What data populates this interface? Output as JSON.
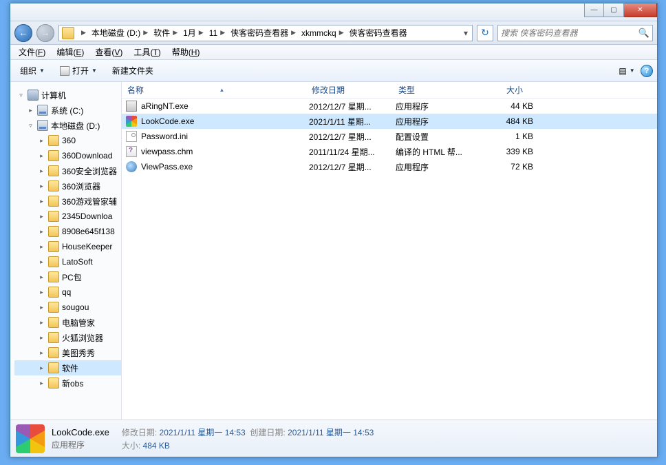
{
  "titlebar": {
    "min": "—",
    "max": "▢",
    "close": "✕"
  },
  "nav": {
    "back": "←",
    "fwd": "→"
  },
  "breadcrumbs": [
    {
      "label": "本地磁盘 (D:)"
    },
    {
      "label": "软件"
    },
    {
      "label": "1月"
    },
    {
      "label": "11"
    },
    {
      "label": "侠客密码查看器"
    },
    {
      "label": "xkmmckq"
    },
    {
      "label": "侠客密码查看器"
    }
  ],
  "search": {
    "placeholder": "搜索 侠客密码查看器"
  },
  "menus": [
    {
      "label": "文件",
      "key": "F"
    },
    {
      "label": "编辑",
      "key": "E"
    },
    {
      "label": "查看",
      "key": "V"
    },
    {
      "label": "工具",
      "key": "T"
    },
    {
      "label": "帮助",
      "key": "H"
    }
  ],
  "toolbar": {
    "organize": "组织",
    "open": "打开",
    "newfolder": "新建文件夹"
  },
  "tree": {
    "computer": "计算机",
    "system": "系统 (C:)",
    "local": "本地磁盘 (D:)",
    "folders": [
      "360",
      "360Download",
      "360安全浏览器",
      "360浏览器",
      "360游戏管家辅",
      "2345Downloa",
      "8908e645f138",
      "HouseKeeper",
      "LatoSoft",
      "PC包",
      "qq",
      "sougou",
      "电脑管家",
      "火狐浏览器",
      "美图秀秀",
      "软件",
      "新obs"
    ]
  },
  "columns": {
    "name": "名称",
    "date": "修改日期",
    "type": "类型",
    "size": "大小"
  },
  "files": [
    {
      "ico": "exe",
      "name": "aRingNT.exe",
      "date": "2012/12/7 星期...",
      "type": "应用程序",
      "size": "44 KB",
      "sel": false
    },
    {
      "ico": "exe2",
      "name": "LookCode.exe",
      "date": "2021/1/11 星期...",
      "type": "应用程序",
      "size": "484 KB",
      "sel": true
    },
    {
      "ico": "ini",
      "name": "Password.ini",
      "date": "2012/12/7 星期...",
      "type": "配置设置",
      "size": "1 KB",
      "sel": false
    },
    {
      "ico": "chm",
      "name": "viewpass.chm",
      "date": "2011/11/24 星期...",
      "type": "编译的 HTML 帮...",
      "size": "339 KB",
      "sel": false
    },
    {
      "ico": "exe3",
      "name": "ViewPass.exe",
      "date": "2012/12/7 星期...",
      "type": "应用程序",
      "size": "72 KB",
      "sel": false
    }
  ],
  "details": {
    "name": "LookCode.exe",
    "type": "应用程序",
    "mod_k": "修改日期:",
    "mod_v": "2021/1/11 星期一 14:53",
    "crt_k": "创建日期:",
    "crt_v": "2021/1/11 星期一 14:53",
    "size_k": "大小:",
    "size_v": "484 KB"
  }
}
